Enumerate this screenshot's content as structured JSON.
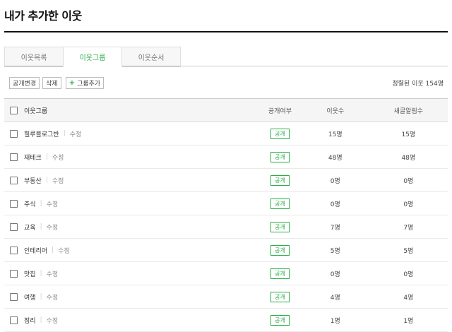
{
  "page": {
    "title": "내가 추가한 이웃"
  },
  "tabs": [
    {
      "label": "이웃목록",
      "active": false
    },
    {
      "label": "이웃그룹",
      "active": true
    },
    {
      "label": "이웃순서",
      "active": false
    }
  ],
  "toolbar": {
    "change_public_label": "공개변경",
    "delete_label": "삭제",
    "add_group_label": "그룹추가",
    "add_group_icon": "plus-icon"
  },
  "sort_status": "정렬된 이웃 154명",
  "table": {
    "headers": {
      "group": "이웃그룹",
      "public": "공개여부",
      "count": "이웃수",
      "new_posts": "새글알림수"
    },
    "rows": [
      {
        "name": "힐루블로그반",
        "edit": "수정",
        "public": "공개",
        "count": "15명",
        "new_posts": "15명"
      },
      {
        "name": "재테크",
        "edit": "수정",
        "public": "공개",
        "count": "48명",
        "new_posts": "48명"
      },
      {
        "name": "부동산",
        "edit": "수정",
        "public": "공개",
        "count": "0명",
        "new_posts": "0명"
      },
      {
        "name": "주식",
        "edit": "수정",
        "public": "공개",
        "count": "0명",
        "new_posts": "0명"
      },
      {
        "name": "교육",
        "edit": "수정",
        "public": "공개",
        "count": "7명",
        "new_posts": "7명"
      },
      {
        "name": "인테리어",
        "edit": "수정",
        "public": "공개",
        "count": "5명",
        "new_posts": "5명"
      },
      {
        "name": "맛집",
        "edit": "수정",
        "public": "공개",
        "count": "0명",
        "new_posts": "0명"
      },
      {
        "name": "여행",
        "edit": "수정",
        "public": "공개",
        "count": "4명",
        "new_posts": "4명"
      },
      {
        "name": "정리",
        "edit": "수정",
        "public": "공개",
        "count": "1명",
        "new_posts": "1명"
      }
    ]
  },
  "colors": {
    "accent": "#2bae4a",
    "title_rule": "#111111",
    "header_bg": "#f5f5f5"
  }
}
